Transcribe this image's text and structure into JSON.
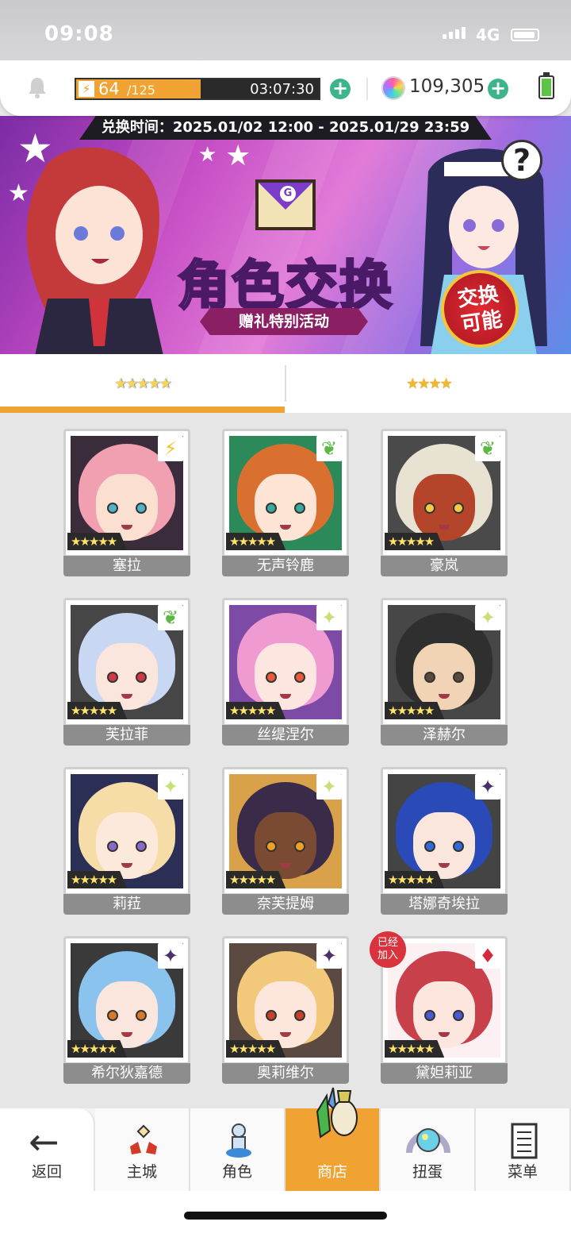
{
  "status_bar": {
    "time": "09:08",
    "network": "4G"
  },
  "header": {
    "stamina_current": "64",
    "stamina_max": "/125",
    "stamina_fraction": 0.512,
    "stamina_timer": "03:07:30",
    "gems": "109,305",
    "bolt_icon": "⚡",
    "plus_label": "+"
  },
  "banner": {
    "date_range": "兑换时间：2025.01/02 12:00 - 2025.01/29 23:59",
    "title": "角色交换",
    "subtitle": "赠礼特别活动",
    "badge_line1": "交换",
    "badge_line2": "可能",
    "help_label": "?",
    "envelope_mark": "G"
  },
  "tabs": [
    {
      "label": "★★★★★",
      "active": true
    },
    {
      "label": "★★★★",
      "active": false
    }
  ],
  "cards": [
    {
      "name": "塞拉",
      "rating": "★★★★★",
      "element": "lightning-icon",
      "element_glyph": "⚡",
      "element_color": "#f3c221",
      "joined": "",
      "bg": "#3a2c3a",
      "hair": "#f0a0b0",
      "skin": "#fbe0d2",
      "eye": "#4fb4c8"
    },
    {
      "name": "无声铃鹿",
      "rating": "★★★★★",
      "element": "leaf-icon",
      "element_glyph": "❦",
      "element_color": "#5cb844",
      "joined": "",
      "bg": "#2c8a5a",
      "hair": "#d9702f",
      "skin": "#fde4d5",
      "eye": "#3aa7a0"
    },
    {
      "name": "豪岚",
      "rating": "★★★★★",
      "element": "leaf-icon",
      "element_glyph": "❦",
      "element_color": "#5cb844",
      "joined": "",
      "bg": "#4a4a4a",
      "hair": "#e8e2d2",
      "skin": "#b5452a",
      "eye": "#f2c94c"
    },
    {
      "name": "芙拉菲",
      "rating": "★★★★★",
      "element": "leaf-icon",
      "element_glyph": "❦",
      "element_color": "#5cb844",
      "joined": "",
      "bg": "#464646",
      "hair": "#c8d8f2",
      "skin": "#fbe6de",
      "eye": "#d0384a"
    },
    {
      "name": "丝缇涅尔",
      "rating": "★★★★★",
      "element": "sparkle-icon",
      "element_glyph": "✦",
      "element_color": "#c9e07a",
      "joined": "",
      "bg": "#7d4aa6",
      "hair": "#f09ad2",
      "skin": "#fde6e0",
      "eye": "#e85a3c"
    },
    {
      "name": "泽赫尔",
      "rating": "★★★★★",
      "element": "sparkle-icon",
      "element_glyph": "✦",
      "element_color": "#c9e07a",
      "joined": "",
      "bg": "#474747",
      "hair": "#2f2f2f",
      "skin": "#f1d3b6",
      "eye": "#5a4a3a"
    },
    {
      "name": "莉菈",
      "rating": "★★★★★",
      "element": "sparkle-icon",
      "element_glyph": "✦",
      "element_color": "#c9e07a",
      "joined": "",
      "bg": "#2c2f55",
      "hair": "#f6dca6",
      "skin": "#fde9dc",
      "eye": "#8a6ac8"
    },
    {
      "name": "奈芙提姆",
      "rating": "★★★★★",
      "element": "sparkle-icon",
      "element_glyph": "✦",
      "element_color": "#c9e07a",
      "joined": "",
      "bg": "#d9a24a",
      "hair": "#3a2b4a",
      "skin": "#7a4a32",
      "eye": "#f0a020"
    },
    {
      "name": "塔娜奇埃拉",
      "rating": "★★★★★",
      "element": "dark-star-icon",
      "element_glyph": "✦",
      "element_color": "#4a2f6a",
      "joined": "",
      "bg": "#444",
      "hair": "#2a4ab8",
      "skin": "#fbe6de",
      "eye": "#2f6ad8"
    },
    {
      "name": "希尔狄嘉德",
      "rating": "★★★★★",
      "element": "dark-star-icon",
      "element_glyph": "✦",
      "element_color": "#4a2f6a",
      "joined": "",
      "bg": "#3a3a3a",
      "hair": "#8ac4ee",
      "skin": "#fbe6de",
      "eye": "#d67a2a"
    },
    {
      "name": "奥莉维尔",
      "rating": "★★★★★",
      "element": "dark-star-icon",
      "element_glyph": "✦",
      "element_color": "#4a2f6a",
      "joined": "",
      "bg": "#5a4a42",
      "hair": "#f2c87a",
      "skin": "#fde6dc",
      "eye": "#c8402a"
    },
    {
      "name": "黛妲莉亚",
      "rating": "★★★★★",
      "element": "diamond-icon",
      "element_glyph": "♦",
      "element_color": "#d22a3a",
      "joined": "已经加入",
      "bg": "#fdf0f2",
      "hair": "#c8404a",
      "skin": "#fde6de",
      "eye": "#4a5ad0"
    }
  ],
  "nav": {
    "back": "返回",
    "home": "主城",
    "character": "角色",
    "shop": "商店",
    "gacha": "扭蛋",
    "menu": "菜单",
    "back_glyph": "←"
  }
}
